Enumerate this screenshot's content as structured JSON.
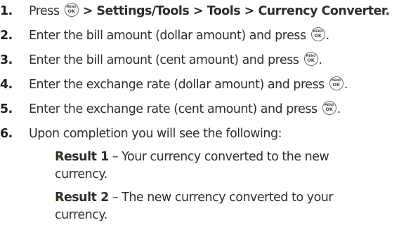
{
  "key_icon": {
    "top": "MENU",
    "bottom": "OK"
  },
  "steps": [
    {
      "number": "1.",
      "prefix": "Press",
      "bold": " > Settings/Tools > Tools > Currency Converter."
    },
    {
      "number": "2.",
      "text": "Enter the bill amount (dollar amount) and press",
      "suffix": "."
    },
    {
      "number": "3.",
      "text": "Enter the bill amount (cent amount) and press",
      "suffix": "."
    },
    {
      "number": "4.",
      "text": "Enter the exchange rate (dollar amount) and press",
      "suffix": "."
    },
    {
      "number": "5.",
      "text": "Enter the exchange rate (cent amount) and press",
      "suffix": "."
    },
    {
      "number": "6.",
      "text": "Upon completion you will see the following:"
    }
  ],
  "results": [
    {
      "label": "Result 1",
      "line1": " – Your currency converted to the new",
      "line2": "currency."
    },
    {
      "label": "Result 2",
      "line1": " – The new currency converted to your",
      "line2": "currency."
    }
  ],
  "colors": {
    "bullet": "#f2b705",
    "text": "#2e2e2e"
  }
}
